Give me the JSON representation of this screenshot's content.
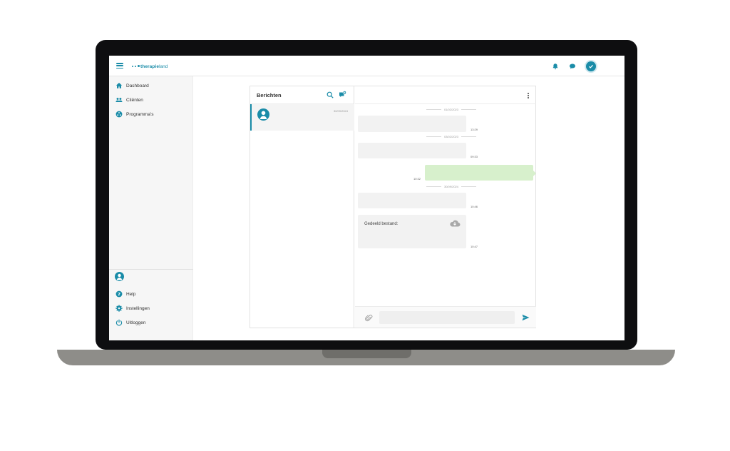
{
  "topbar": {
    "logo": {
      "text_bold": "therapie",
      "text_regular": "land"
    },
    "icons": [
      "menu-icon",
      "bell-icon",
      "chat-icon",
      "check-icon"
    ]
  },
  "sidebar": {
    "items": [
      {
        "label": "Dashboard",
        "icon": "home-icon"
      },
      {
        "label": "Cliënten",
        "icon": "users-icon"
      },
      {
        "label": "Programma's",
        "icon": "programs-icon"
      }
    ],
    "bottom_items": [
      {
        "label": "Help",
        "icon": "help-icon"
      },
      {
        "label": "Instellingen",
        "icon": "gear-icon"
      },
      {
        "label": "Uitloggen",
        "icon": "power-icon"
      }
    ]
  },
  "messages": {
    "title": "Berichten",
    "conversations": [
      {
        "date": "30/09/2024",
        "icon": "user-avatar-icon"
      }
    ]
  },
  "chat": {
    "separators": [
      "01/02/2023",
      "03/02/2023",
      "30/09/2024"
    ],
    "messages": [
      {
        "direction": "in",
        "time": "13:29"
      },
      {
        "direction": "in",
        "time": "09:33"
      },
      {
        "direction": "out",
        "time": "10:32"
      },
      {
        "direction": "in",
        "time": "10:46"
      },
      {
        "direction": "in",
        "time": "10:47",
        "text": "Gedeeld bestand:",
        "icon": "cloud-download-icon"
      }
    ],
    "composer": {
      "placeholder": ""
    }
  },
  "colors": {
    "accent": "#1a8ca8",
    "outgoing": "#d7f0cc",
    "incoming": "#f2f2f2",
    "bezel": "#0e0e10",
    "laptop_base": "#8e8d89"
  }
}
